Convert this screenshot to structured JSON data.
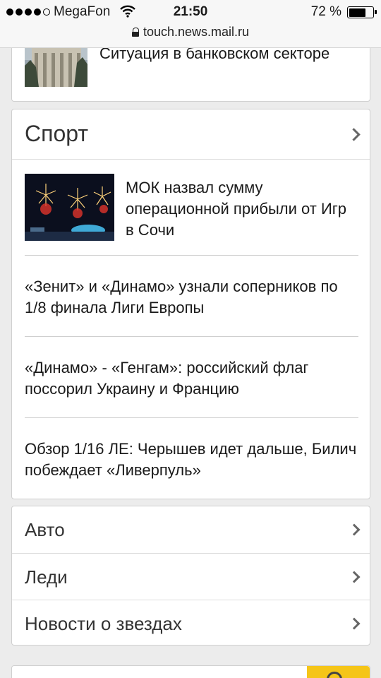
{
  "status_bar": {
    "carrier": "MegaFon",
    "time": "21:50",
    "battery_percent": "72 %",
    "battery_level": 0.72,
    "url": "touch.news.mail.ru"
  },
  "top_story": {
    "title": "Ситуация в банковском секторе"
  },
  "sport": {
    "header": "Спорт",
    "featured": {
      "title": "МОК назвал сумму операционной прибыли от Игр в Сочи"
    },
    "items": [
      "«Зенит» и «Динамо» узнали соперников по 1/8 финала Лиги Европы",
      "«Динамо» - «Генгам»: российский флаг поссорил Украину и Францию",
      "Обзор 1/16 ЛЕ: Черышев идет дальше, Билич побеждает «Ливерпуль»"
    ]
  },
  "categories": [
    "Авто",
    "Леди",
    "Новости о звездах"
  ],
  "icons": {
    "signal": "signal-dots-icon",
    "wifi": "wifi-icon",
    "battery": "battery-icon",
    "lock": "lock-icon",
    "chevron": "chevron-right-icon",
    "search": "search-icon"
  },
  "colors": {
    "search_button": "#f5c518",
    "background": "#ececec"
  }
}
